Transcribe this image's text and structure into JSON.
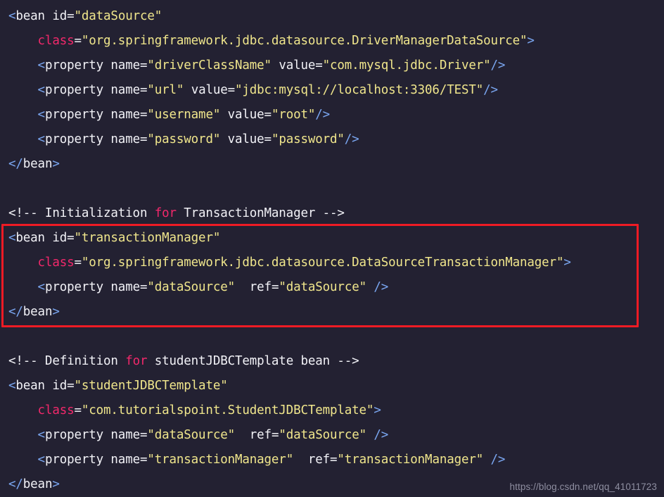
{
  "editor": {
    "background_color": "#232132",
    "language": "xml",
    "theme": "dark-navy",
    "lines": [
      {
        "index": 1,
        "indent": 0,
        "tokens": [
          {
            "kind": "punct",
            "text": "<"
          },
          {
            "kind": "tag",
            "text": "bean"
          },
          {
            "kind": "plain",
            "text": " "
          },
          {
            "kind": "attr",
            "text": "id"
          },
          {
            "kind": "eq",
            "text": "="
          },
          {
            "kind": "str",
            "text": "\"dataSource\""
          }
        ]
      },
      {
        "index": 2,
        "indent": 1,
        "tokens": [
          {
            "kind": "attr-kw",
            "text": "class"
          },
          {
            "kind": "eq",
            "text": "="
          },
          {
            "kind": "str",
            "text": "\"org.springframework.jdbc.datasource.DriverManagerDataSource\""
          },
          {
            "kind": "punct",
            "text": ">"
          }
        ]
      },
      {
        "index": 3,
        "indent": 1,
        "tokens": [
          {
            "kind": "punct",
            "text": "<"
          },
          {
            "kind": "tag",
            "text": "property"
          },
          {
            "kind": "plain",
            "text": " "
          },
          {
            "kind": "attr",
            "text": "name"
          },
          {
            "kind": "eq",
            "text": "="
          },
          {
            "kind": "str",
            "text": "\"driverClassName\""
          },
          {
            "kind": "plain",
            "text": " "
          },
          {
            "kind": "attr",
            "text": "value"
          },
          {
            "kind": "eq",
            "text": "="
          },
          {
            "kind": "str",
            "text": "\"com.mysql.jdbc.Driver\""
          },
          {
            "kind": "punct",
            "text": "/>"
          }
        ]
      },
      {
        "index": 4,
        "indent": 1,
        "tokens": [
          {
            "kind": "punct",
            "text": "<"
          },
          {
            "kind": "tag",
            "text": "property"
          },
          {
            "kind": "plain",
            "text": " "
          },
          {
            "kind": "attr",
            "text": "name"
          },
          {
            "kind": "eq",
            "text": "="
          },
          {
            "kind": "str",
            "text": "\"url\""
          },
          {
            "kind": "plain",
            "text": " "
          },
          {
            "kind": "attr",
            "text": "value"
          },
          {
            "kind": "eq",
            "text": "="
          },
          {
            "kind": "str",
            "text": "\"jdbc:mysql://localhost:3306/TEST\""
          },
          {
            "kind": "punct",
            "text": "/>"
          }
        ]
      },
      {
        "index": 5,
        "indent": 1,
        "tokens": [
          {
            "kind": "punct",
            "text": "<"
          },
          {
            "kind": "tag",
            "text": "property"
          },
          {
            "kind": "plain",
            "text": " "
          },
          {
            "kind": "attr",
            "text": "name"
          },
          {
            "kind": "eq",
            "text": "="
          },
          {
            "kind": "str",
            "text": "\"username\""
          },
          {
            "kind": "plain",
            "text": " "
          },
          {
            "kind": "attr",
            "text": "value"
          },
          {
            "kind": "eq",
            "text": "="
          },
          {
            "kind": "str",
            "text": "\"root\""
          },
          {
            "kind": "punct",
            "text": "/>"
          }
        ]
      },
      {
        "index": 6,
        "indent": 1,
        "tokens": [
          {
            "kind": "punct",
            "text": "<"
          },
          {
            "kind": "tag",
            "text": "property"
          },
          {
            "kind": "plain",
            "text": " "
          },
          {
            "kind": "attr",
            "text": "name"
          },
          {
            "kind": "eq",
            "text": "="
          },
          {
            "kind": "str",
            "text": "\"password\""
          },
          {
            "kind": "plain",
            "text": " "
          },
          {
            "kind": "attr",
            "text": "value"
          },
          {
            "kind": "eq",
            "text": "="
          },
          {
            "kind": "str",
            "text": "\"password\""
          },
          {
            "kind": "punct",
            "text": "/>"
          }
        ]
      },
      {
        "index": 7,
        "indent": 0,
        "tokens": [
          {
            "kind": "punct",
            "text": "</"
          },
          {
            "kind": "tag",
            "text": "bean"
          },
          {
            "kind": "punct",
            "text": ">"
          }
        ]
      },
      {
        "index": 8,
        "indent": 0,
        "blank": true,
        "tokens": []
      },
      {
        "index": 9,
        "indent": 0,
        "tokens": [
          {
            "kind": "comment",
            "text": "<!-- Initialization "
          },
          {
            "kind": "kw",
            "text": "for"
          },
          {
            "kind": "comment",
            "text": " TransactionManager -->"
          }
        ]
      },
      {
        "index": 10,
        "indent": 0,
        "highlighted": true,
        "tokens": [
          {
            "kind": "punct",
            "text": "<"
          },
          {
            "kind": "tag",
            "text": "bean"
          },
          {
            "kind": "plain",
            "text": " "
          },
          {
            "kind": "attr",
            "text": "id"
          },
          {
            "kind": "eq",
            "text": "="
          },
          {
            "kind": "str",
            "text": "\"transactionManager\""
          }
        ]
      },
      {
        "index": 11,
        "indent": 1,
        "highlighted": true,
        "tokens": [
          {
            "kind": "attr-kw",
            "text": "class"
          },
          {
            "kind": "eq",
            "text": "="
          },
          {
            "kind": "str",
            "text": "\"org.springframework.jdbc.datasource.DataSourceTransactionManager\""
          },
          {
            "kind": "punct",
            "text": ">"
          }
        ]
      },
      {
        "index": 12,
        "indent": 1,
        "highlighted": true,
        "tokens": [
          {
            "kind": "punct",
            "text": "<"
          },
          {
            "kind": "tag",
            "text": "property"
          },
          {
            "kind": "plain",
            "text": " "
          },
          {
            "kind": "attr",
            "text": "name"
          },
          {
            "kind": "eq",
            "text": "="
          },
          {
            "kind": "str",
            "text": "\"dataSource\""
          },
          {
            "kind": "plain",
            "text": "  "
          },
          {
            "kind": "attr",
            "text": "ref"
          },
          {
            "kind": "eq",
            "text": "="
          },
          {
            "kind": "str",
            "text": "\"dataSource\""
          },
          {
            "kind": "plain",
            "text": " "
          },
          {
            "kind": "punct",
            "text": "/>"
          }
        ]
      },
      {
        "index": 13,
        "indent": 0,
        "highlighted": true,
        "tokens": [
          {
            "kind": "punct",
            "text": "</"
          },
          {
            "kind": "tag",
            "text": "bean"
          },
          {
            "kind": "punct",
            "text": ">"
          }
        ]
      },
      {
        "index": 14,
        "indent": 0,
        "blank": true,
        "tokens": []
      },
      {
        "index": 15,
        "indent": 0,
        "tokens": [
          {
            "kind": "comment",
            "text": "<!-- Definition "
          },
          {
            "kind": "kw",
            "text": "for"
          },
          {
            "kind": "comment",
            "text": " studentJDBCTemplate bean -->"
          }
        ]
      },
      {
        "index": 16,
        "indent": 0,
        "tokens": [
          {
            "kind": "punct",
            "text": "<"
          },
          {
            "kind": "tag",
            "text": "bean"
          },
          {
            "kind": "plain",
            "text": " "
          },
          {
            "kind": "attr",
            "text": "id"
          },
          {
            "kind": "eq",
            "text": "="
          },
          {
            "kind": "str",
            "text": "\"studentJDBCTemplate\""
          }
        ]
      },
      {
        "index": 17,
        "indent": 1,
        "tokens": [
          {
            "kind": "attr-kw",
            "text": "class"
          },
          {
            "kind": "eq",
            "text": "="
          },
          {
            "kind": "str",
            "text": "\"com.tutorialspoint.StudentJDBCTemplate\""
          },
          {
            "kind": "punct",
            "text": ">"
          }
        ]
      },
      {
        "index": 18,
        "indent": 1,
        "tokens": [
          {
            "kind": "punct",
            "text": "<"
          },
          {
            "kind": "tag",
            "text": "property"
          },
          {
            "kind": "plain",
            "text": " "
          },
          {
            "kind": "attr",
            "text": "name"
          },
          {
            "kind": "eq",
            "text": "="
          },
          {
            "kind": "str",
            "text": "\"dataSource\""
          },
          {
            "kind": "plain",
            "text": "  "
          },
          {
            "kind": "attr",
            "text": "ref"
          },
          {
            "kind": "eq",
            "text": "="
          },
          {
            "kind": "str",
            "text": "\"dataSource\""
          },
          {
            "kind": "plain",
            "text": " "
          },
          {
            "kind": "punct",
            "text": "/>"
          }
        ]
      },
      {
        "index": 19,
        "indent": 1,
        "tokens": [
          {
            "kind": "punct",
            "text": "<"
          },
          {
            "kind": "tag",
            "text": "property"
          },
          {
            "kind": "plain",
            "text": " "
          },
          {
            "kind": "attr",
            "text": "name"
          },
          {
            "kind": "eq",
            "text": "="
          },
          {
            "kind": "str",
            "text": "\"transactionManager\""
          },
          {
            "kind": "plain",
            "text": "  "
          },
          {
            "kind": "attr",
            "text": "ref"
          },
          {
            "kind": "eq",
            "text": "="
          },
          {
            "kind": "str",
            "text": "\"transactionManager\""
          },
          {
            "kind": "plain",
            "text": " "
          },
          {
            "kind": "punct",
            "text": "/>"
          }
        ]
      },
      {
        "index": 20,
        "indent": 0,
        "tokens": [
          {
            "kind": "punct",
            "text": "</"
          },
          {
            "kind": "tag",
            "text": "bean"
          },
          {
            "kind": "punct",
            "text": ">"
          }
        ]
      }
    ]
  },
  "annotation": {
    "type": "rectangle-highlight",
    "color": "#ee1b24",
    "covers_lines": [
      10,
      11,
      12,
      13
    ]
  },
  "watermark": {
    "text": "https://blog.csdn.net/qq_41011723",
    "color": "#8e8ea0"
  }
}
